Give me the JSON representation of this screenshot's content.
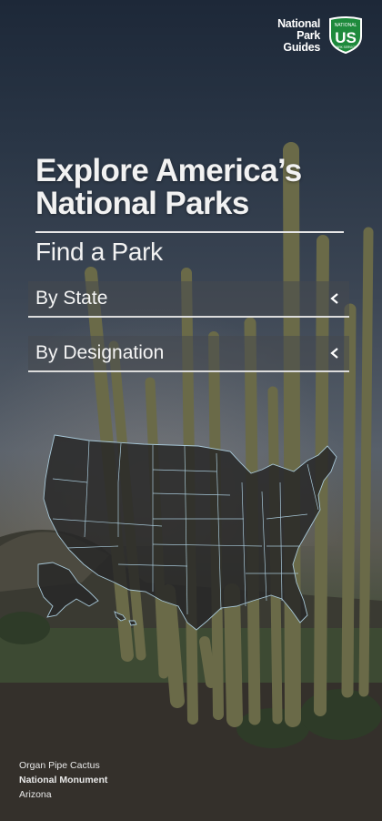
{
  "brand": {
    "name_line1": "National",
    "name_line2": "Park",
    "name_line3": "Guides",
    "shield_top": "NATIONAL",
    "shield_main": "US",
    "shield_bottom": "PARK SERVICE",
    "shield_color": "#1e8a3c"
  },
  "hero": {
    "title_line1": "Explore America’s",
    "title_line2": "National Parks"
  },
  "find": {
    "label": "Find a Park",
    "options": [
      {
        "label": "By State",
        "icon": "chevron-left-icon"
      },
      {
        "label": "By Designation",
        "icon": "chevron-left-icon"
      }
    ]
  },
  "map": {
    "icon": "us-map-icon",
    "fill": "#2b2b2b",
    "stroke": "#a8c8d8"
  },
  "photo_caption": {
    "line1": "Organ Pipe Cactus",
    "line2": "National Monument",
    "line3": "Arizona"
  }
}
